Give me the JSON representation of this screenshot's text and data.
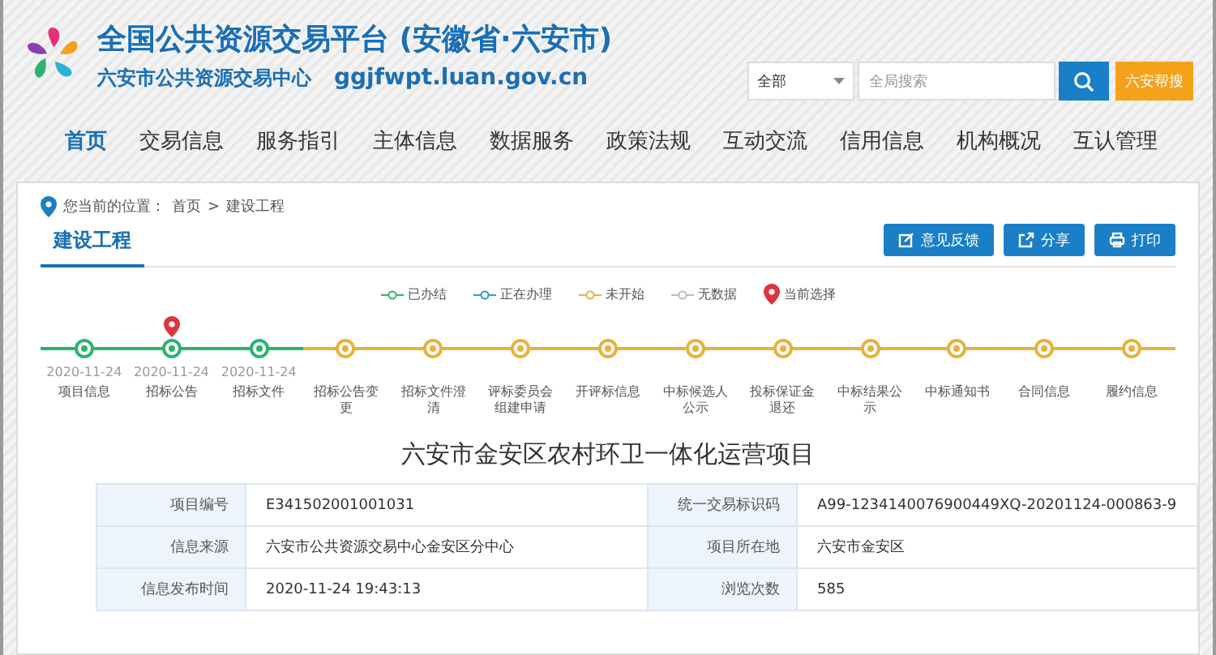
{
  "header": {
    "title": "全国公共资源交易平台 (安徽省·六安市)",
    "subtitle": "六安市公共资源交易中心",
    "domain": "ggjfwpt.luan.gov.cn"
  },
  "search": {
    "scope": "全部",
    "placeholder": "全局搜索",
    "extra_button": "六安帮搜"
  },
  "nav": [
    {
      "label": "首页",
      "selected": true
    },
    {
      "label": "交易信息",
      "selected": false
    },
    {
      "label": "服务指引",
      "selected": false
    },
    {
      "label": "主体信息",
      "selected": false
    },
    {
      "label": "数据服务",
      "selected": false
    },
    {
      "label": "政策法规",
      "selected": false
    },
    {
      "label": "互动交流",
      "selected": false
    },
    {
      "label": "信用信息",
      "selected": false
    },
    {
      "label": "机构概况",
      "selected": false
    },
    {
      "label": "互认管理",
      "selected": false
    }
  ],
  "breadcrumb": {
    "prefix": "您当前的位置：",
    "items": [
      "首页",
      "建设工程"
    ],
    "separator": ">"
  },
  "section_tab": "建设工程",
  "actions": [
    {
      "kind": "feedback",
      "label": "意见反馈"
    },
    {
      "kind": "share",
      "label": "分享"
    },
    {
      "kind": "print",
      "label": "打印"
    }
  ],
  "legend": [
    {
      "kind": "done",
      "label": "已办结",
      "color": "#2db36f"
    },
    {
      "kind": "active",
      "label": "正在办理",
      "color": "#2a9ad6"
    },
    {
      "kind": "pending",
      "label": "未开始",
      "color": "#e8b23a"
    },
    {
      "kind": "nodata",
      "label": "无数据",
      "color": "#bbbbbb"
    },
    {
      "kind": "current",
      "label": "当前选择",
      "color": "#d9363e"
    }
  ],
  "timeline": [
    {
      "label": "项目信息",
      "date": "2020-11-24",
      "kind": "done",
      "selected": false
    },
    {
      "label": "招标公告",
      "date": "2020-11-24",
      "kind": "done",
      "selected": true
    },
    {
      "label": "招标文件",
      "date": "2020-11-24",
      "kind": "done",
      "selected": false
    },
    {
      "label": "招标公告变更",
      "kind": "pending",
      "selected": false
    },
    {
      "label": "招标文件澄清",
      "kind": "pending",
      "selected": false
    },
    {
      "label": "评标委员会组建申请",
      "kind": "pending",
      "selected": false
    },
    {
      "label": "开评标信息",
      "kind": "pending",
      "selected": false
    },
    {
      "label": "中标候选人公示",
      "kind": "pending",
      "selected": false
    },
    {
      "label": "投标保证金退还",
      "kind": "pending",
      "selected": false
    },
    {
      "label": "中标结果公示",
      "kind": "pending",
      "selected": false
    },
    {
      "label": "中标通知书",
      "kind": "pending",
      "selected": false
    },
    {
      "label": "合同信息",
      "kind": "pending",
      "selected": false
    },
    {
      "label": "履约信息",
      "kind": "pending",
      "selected": false
    }
  ],
  "project_title": "六安市金安区农村环卫一体化运营项目",
  "details": [
    [
      {
        "label": "项目编号",
        "value": "E341502001001031"
      },
      {
        "label": "统一交易标识码",
        "value": "A99-1234140076900449XQ-20201124-000863-9"
      }
    ],
    [
      {
        "label": "信息来源",
        "value": "六安市公共资源交易中心金安区分中心"
      },
      {
        "label": "项目所在地",
        "value": "六安市金安区"
      }
    ],
    [
      {
        "label": "信息发布时间",
        "value": "2020-11-24 19:43:13"
      },
      {
        "label": "浏览次数",
        "value": "585"
      }
    ]
  ]
}
